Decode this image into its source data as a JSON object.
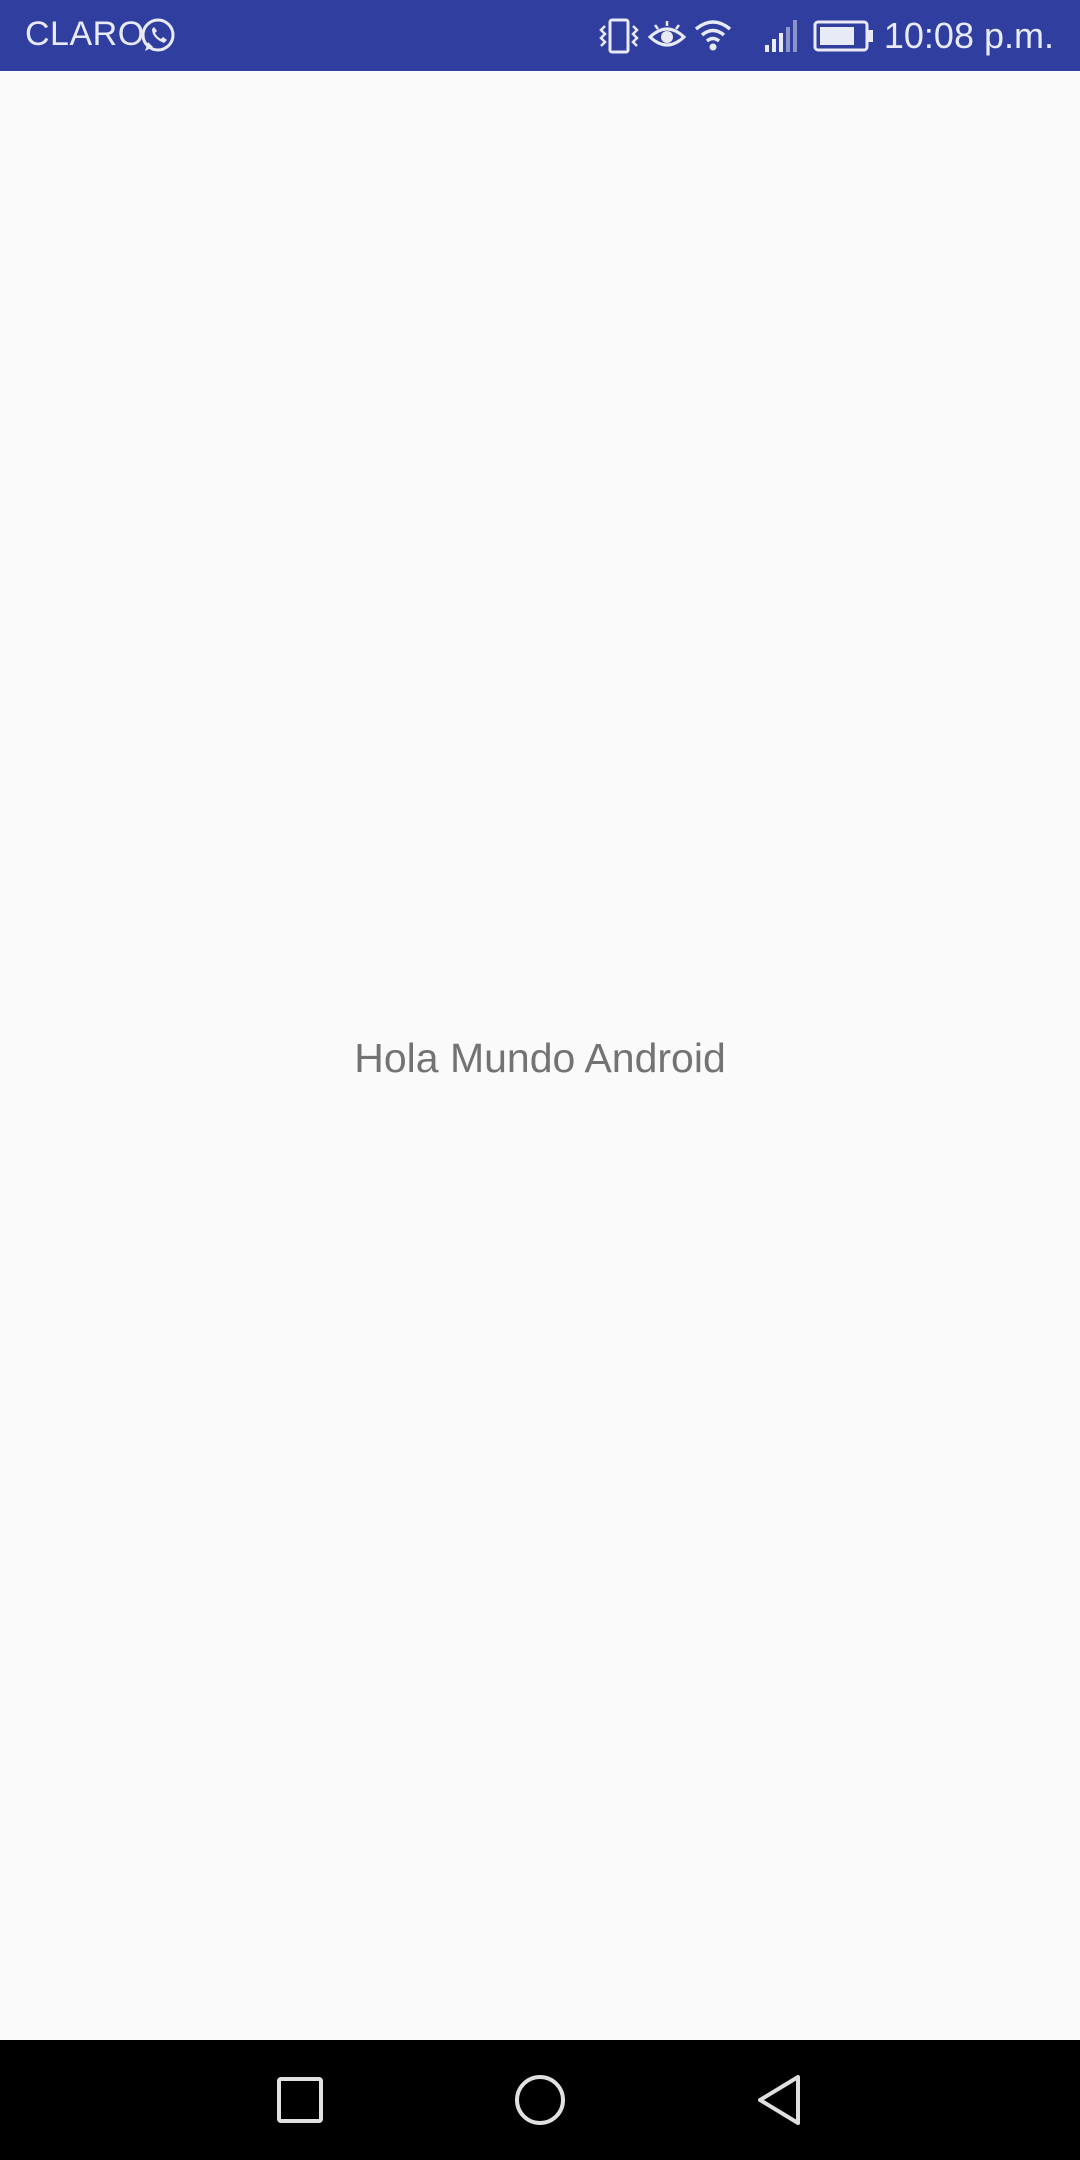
{
  "status_bar": {
    "carrier": "CLARO",
    "time": "10:08 p.m.",
    "icons": [
      "whatsapp-icon",
      "vibrate-icon",
      "eye-icon",
      "wifi-icon",
      "signal-icon",
      "battery-icon"
    ],
    "background_color": "#303f9f"
  },
  "main": {
    "text": "Hola Mundo Android",
    "text_color": "#737373",
    "background_color": "#fafafa"
  },
  "nav_bar": {
    "buttons": [
      "recents-button",
      "home-button",
      "back-button"
    ],
    "background_color": "#000000"
  }
}
